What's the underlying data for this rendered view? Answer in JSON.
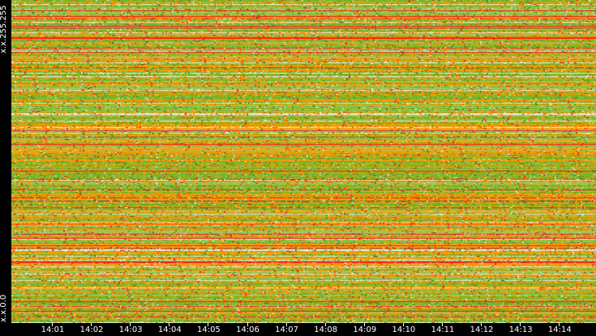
{
  "chart_data": {
    "type": "heatmap",
    "title": "",
    "ylabel_top": "x.x.255.255",
    "ylabel_bottom": "x.x.0.0",
    "x_ticks": [
      "14:01",
      "14:02",
      "14:03",
      "14:04",
      "14:05",
      "14:06",
      "14:07",
      "14:08",
      "14:09",
      "14:10",
      "14:11",
      "14:12",
      "14:13",
      "14:14"
    ],
    "x_range": [
      "14:00:20",
      "14:14:50"
    ],
    "colors": {
      "low": "#e8f0e0",
      "light": "#9ccc6a",
      "mid": "#6fb72a",
      "dark": "#2f7a1a",
      "high": "#ff9900",
      "max": "#ff1a1a"
    }
  }
}
